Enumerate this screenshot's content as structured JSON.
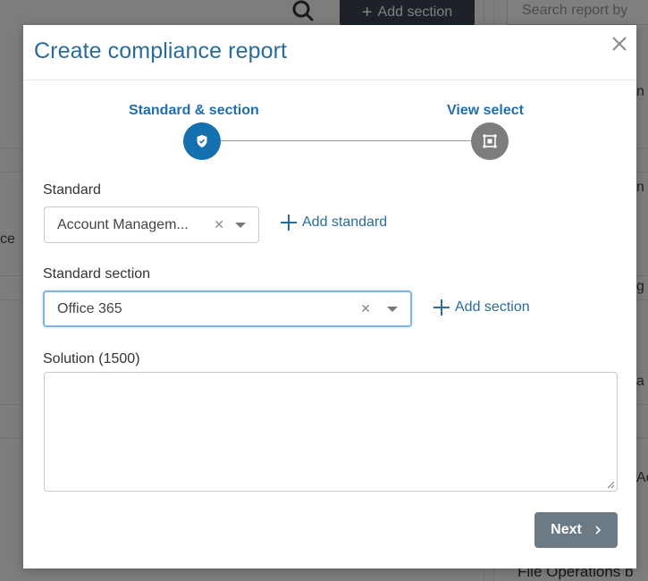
{
  "background": {
    "add_section_button": "Add section",
    "search_placeholder": "Search report by",
    "bottom_text": "File Operations b",
    "fragments": {
      "left": "ce",
      "right_1": "n",
      "right_2": "n",
      "right_3": "g",
      "right_4": "a",
      "right_5": "Ac"
    }
  },
  "modal": {
    "title": "Create compliance report",
    "stepper": {
      "steps": [
        {
          "label": "Standard & section",
          "state": "active",
          "icon": "shield-icon"
        },
        {
          "label": "View select",
          "state": "inactive",
          "icon": "view-select-icon"
        }
      ]
    },
    "standard": {
      "label": "Standard",
      "value": "Account Managem...",
      "add_label": "Add standard"
    },
    "section": {
      "label": "Standard section",
      "value": "Office 365",
      "add_label": "Add section"
    },
    "solution": {
      "label": "Solution (1500)",
      "value": ""
    },
    "next_label": "Next",
    "colors": {
      "accent": "#2a6b98",
      "step_active": "#1470ae",
      "step_inactive": "#7d7d7d",
      "next_button": "#6c7a86"
    }
  }
}
